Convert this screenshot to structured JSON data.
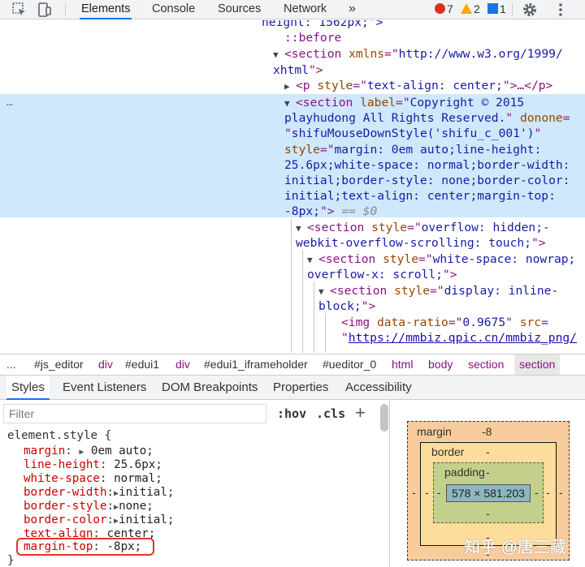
{
  "toolbar": {
    "tabs": [
      "Elements",
      "Console",
      "Sources",
      "Network"
    ],
    "more": "»",
    "errors": "7",
    "warnings": "2",
    "info": "1",
    "colors": {
      "active_tab": "#1a73e8",
      "error": "#d93025",
      "warning": "#f9ab00",
      "info": "#1a73e8"
    }
  },
  "tree": {
    "partial_top": "height: 1562px;\">",
    "before": "::before",
    "section1_open": "<section",
    "section1_attr_name": "xmlns",
    "section1_attr_val_a": "http://www.w3.org/1999/",
    "section1_attr_val_b": "xhtml",
    "p_open": "<p",
    "p_attr": "style",
    "p_val": "text-align: center;",
    "p_tail": "…</p>",
    "ellipsis": "…",
    "sel_open": "<section",
    "sel_label_name": "label",
    "sel_label_val_a": "Copyright © 2015",
    "sel_label_val_b": "playhudong All Rights Reserved.",
    "sel_donone_name": "donone",
    "sel_donone_val": "shifuMouseDownStyle('shifu_c_001')",
    "sel_style_name": "style",
    "sel_style_l1": "margin: 0em auto;line-height:",
    "sel_style_l2": "25.6px;white-space: normal;border-width:",
    "sel_style_l3": "initial;border-style: none;border-color:",
    "sel_style_l4": "initial;text-align: center;margin-top:",
    "sel_style_l5": "-8px;",
    "sel_eq": "== $0",
    "c1_open": "<section",
    "c1_attr": "style",
    "c1_val_a": "overflow: hidden;-",
    "c1_val_b": "webkit-overflow-scrolling: touch;",
    "c2_open": "<section",
    "c2_attr": "style",
    "c2_val_a": "white-space: nowrap;",
    "c2_val_b": "overflow-x: scroll;",
    "c3_open": "<section",
    "c3_attr": "style",
    "c3_val_a": "display: inline-",
    "c3_val_b": "block;",
    "img_open": "<img",
    "img_attr1": "data-ratio",
    "img_val1": "0.9675",
    "img_attr2": "src",
    "img_link": "https://mmbiz.qpic.cn/mmbiz_png/"
  },
  "breadcrumb": [
    "...",
    "#js_editor",
    "div",
    "#edui1",
    "div",
    "#edui1_iframeholder",
    "#ueditor_0",
    "html",
    "body",
    "section",
    "section"
  ],
  "subtabs": [
    "Styles",
    "Event Listeners",
    "DOM Breakpoints",
    "Properties",
    "Accessibility"
  ],
  "styles": {
    "filter_placeholder": "Filter",
    "hov": ":hov",
    "cls": ".cls",
    "plus": "+",
    "selector": "element.style {",
    "declarations": [
      {
        "name": "margin",
        "value": "0em auto;",
        "expand": true
      },
      {
        "name": "line-height",
        "value": "25.6px;",
        "expand": false
      },
      {
        "name": "white-space",
        "value": "normal;",
        "expand": false
      },
      {
        "name": "border-width",
        "value": "initial;",
        "expand": true
      },
      {
        "name": "border-style",
        "value": "none;",
        "expand": true
      },
      {
        "name": "border-color",
        "value": "initial;",
        "expand": true
      },
      {
        "name": "text-align",
        "value": "center;",
        "expand": false
      },
      {
        "name": "margin-top",
        "value": "-8px;",
        "expand": false
      }
    ],
    "close": "}"
  },
  "boxmodel": {
    "margin_label": "margin",
    "margin_top": "-8",
    "border_label": "border",
    "border_top": "-",
    "padding_label": "padding",
    "padding_top": "-",
    "content": "578 × 581.203",
    "dash": "-",
    "colors": {
      "margin": "#f9cc9d",
      "border": "#fddd9b",
      "padding": "#c3d08b",
      "content": "#8cb6c0"
    }
  },
  "watermark": "知乎 @唐三藏"
}
